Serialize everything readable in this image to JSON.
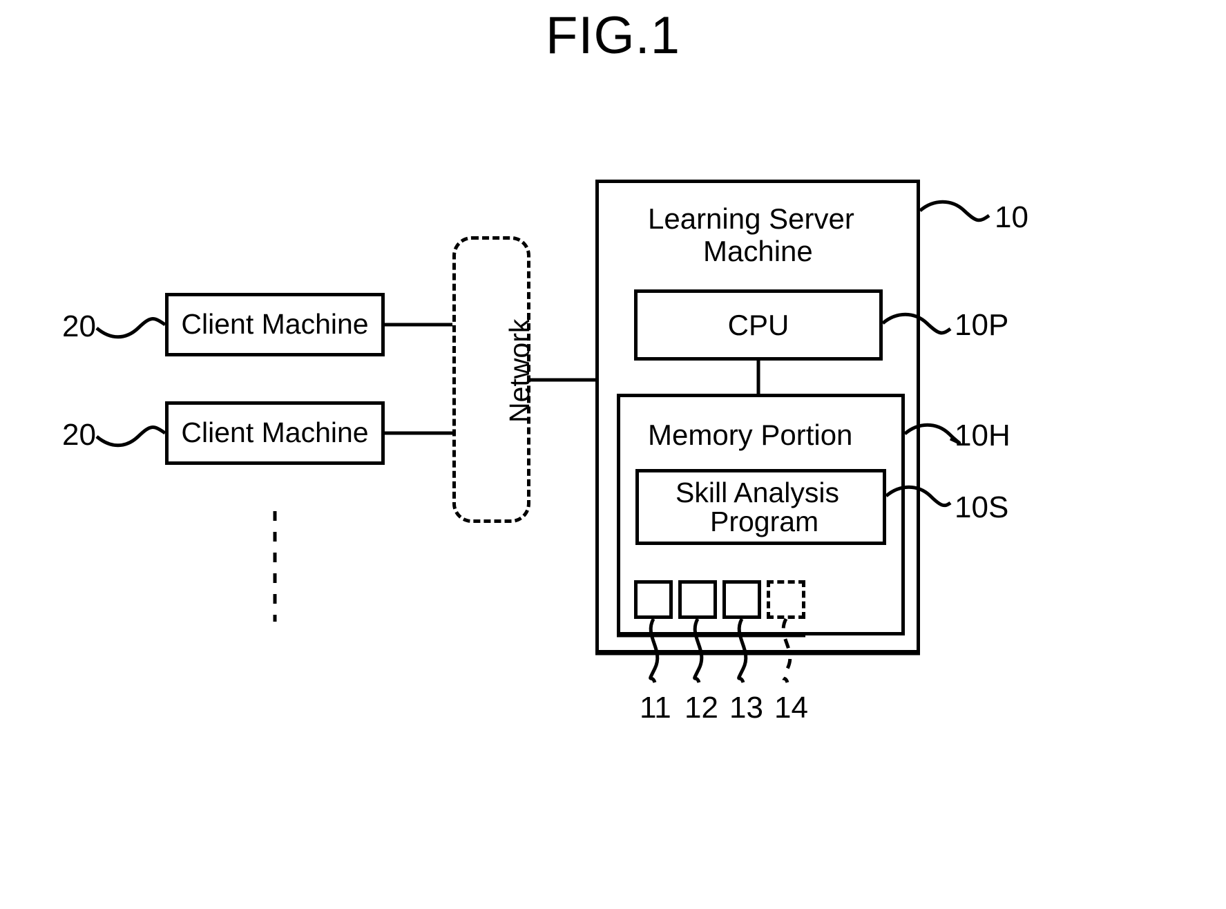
{
  "figure": {
    "title": "FIG.1",
    "type": "patent-block-diagram"
  },
  "nodes": {
    "client_machine_1": {
      "label": "Client Machine",
      "ref": "20"
    },
    "client_machine_2": {
      "label": "Client Machine",
      "ref": "20"
    },
    "network": {
      "label": "Network",
      "style": "dashed-rounded"
    },
    "learning_server_machine": {
      "label": "Learning Server\nMachine",
      "title_line1": "Learning Server",
      "title_line2": "Machine",
      "ref": "10"
    },
    "cpu": {
      "label": "CPU",
      "ref": "10P"
    },
    "memory_portion": {
      "label": "Memory Portion",
      "ref": "10H"
    },
    "skill_analysis_program": {
      "title_line1": "Skill Analysis",
      "title_line2": "Program",
      "ref": "10S"
    }
  },
  "data_boxes": [
    {
      "ref": "11",
      "style": "solid"
    },
    {
      "ref": "12",
      "style": "solid"
    },
    {
      "ref": "13",
      "style": "solid"
    },
    {
      "ref": "14",
      "style": "dashed"
    }
  ],
  "reference_numerals": {
    "client_1": "20",
    "client_2": "20",
    "server": "10",
    "cpu": "10P",
    "memory": "10H",
    "program": "10S",
    "box_11": "11",
    "box_12": "12",
    "box_13": "13",
    "box_14": "14"
  },
  "ellipsis": {
    "style": "vertical-dotted",
    "meaning": "more client machines"
  },
  "colors": {
    "stroke": "#000000",
    "background": "#ffffff"
  }
}
